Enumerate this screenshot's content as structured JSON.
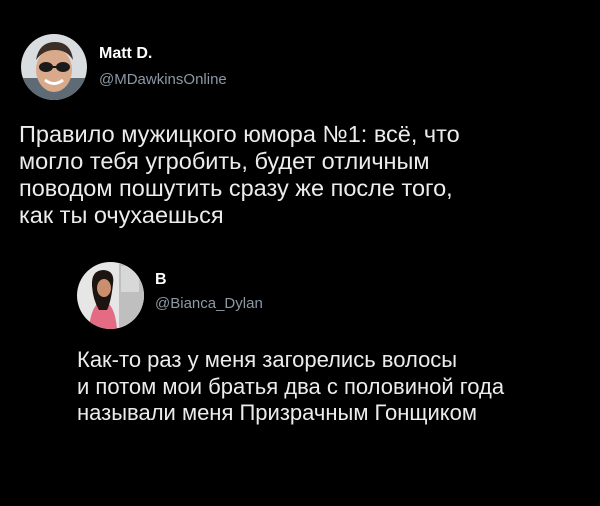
{
  "main_tweet": {
    "author_name": "Matt D.",
    "author_handle": "@MDawkinsOnline",
    "lines": [
      "Правило мужицкого юмора №1: всё, что",
      "могло тебя угробить, будет отличным",
      "поводом пошутить сразу же после того,",
      "как ты очухаешься"
    ]
  },
  "reply_tweet": {
    "author_name": "B",
    "author_handle": "@Bianca_Dylan",
    "lines": [
      "Как-то раз у меня загорелись волосы",
      "и потом мои братья два с половиной года",
      "называли меня Призрачным Гонщиком"
    ]
  },
  "colors": {
    "background": "#000000",
    "name": "#ffffff",
    "handle": "#8b98a5",
    "text": "#ececec"
  }
}
